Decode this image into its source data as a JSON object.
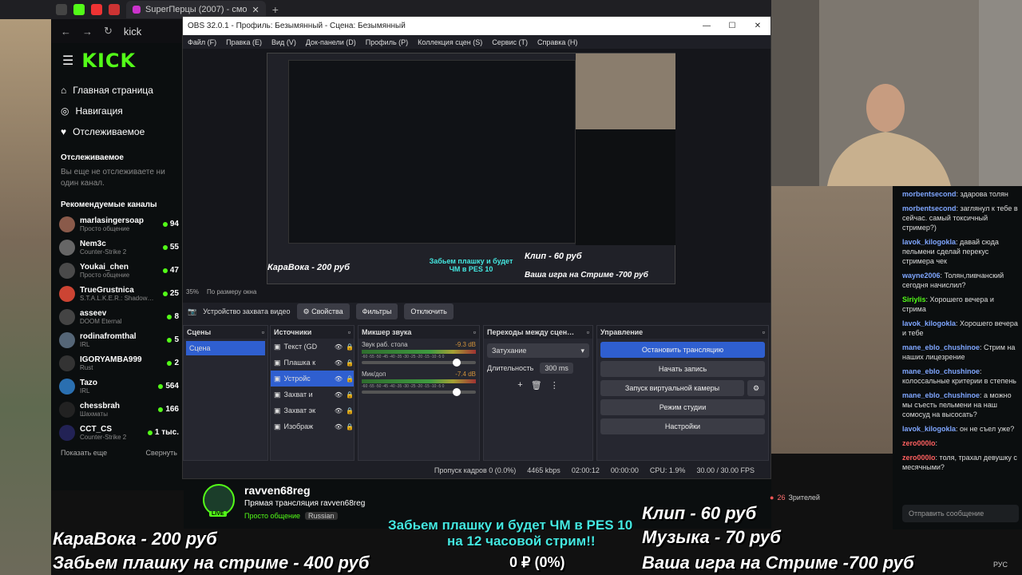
{
  "browser": {
    "tab_title": "SuperПерцы (2007) - смо",
    "address_prefix": "kick"
  },
  "kick": {
    "logo": "KICK",
    "nav": [
      {
        "label": "Главная страница",
        "icon": "home-icon"
      },
      {
        "label": "Навигация",
        "icon": "compass-icon"
      },
      {
        "label": "Отслеживаемое",
        "icon": "heart-icon"
      }
    ],
    "following_title": "Отслеживаемое",
    "following_empty": "Вы еще не отслеживаете ни один канал.",
    "recommended_title": "Рекомендуемые каналы",
    "channels": [
      {
        "name": "marlasingersoap",
        "category": "Просто общение",
        "viewers": "94"
      },
      {
        "name": "Nem3c",
        "category": "Counter-Strike 2",
        "viewers": "55"
      },
      {
        "name": "Youkai_chen",
        "category": "Просто общение",
        "viewers": "47"
      },
      {
        "name": "TrueGrustnica",
        "category": "S.T.A.L.K.E.R.: Shadow…",
        "viewers": "25"
      },
      {
        "name": "asseev",
        "category": "DOOM Eternal",
        "viewers": "8"
      },
      {
        "name": "rodinafromthal",
        "category": "IRL",
        "viewers": "5"
      },
      {
        "name": "IGORYAMBA999",
        "category": "Rust",
        "viewers": "2"
      },
      {
        "name": "Tazo",
        "category": "IRL",
        "viewers": "564"
      },
      {
        "name": "chessbrah",
        "category": "Шахматы",
        "viewers": "166"
      },
      {
        "name": "CCT_CS",
        "category": "Counter-Strike 2",
        "viewers": "1 тыс."
      }
    ],
    "show_more": "Показать еще",
    "collapse": "Свернуть"
  },
  "obs": {
    "title": "OBS 32.0.1 - Профиль: Безымянный - Сцена: Безымянный",
    "menu": [
      "Файл (F)",
      "Правка (E)",
      "Вид (V)",
      "Док-панели (D)",
      "Профиль (P)",
      "Коллекция сцен (S)",
      "Сервис (T)",
      "Справка (H)"
    ],
    "zoom": "35%",
    "zoom_mode": "По размеру окна",
    "source_toolbar": {
      "device": "Устройство захвата видео",
      "properties": "Свойства",
      "filters": "Фильтры",
      "deactivate": "Отключить"
    },
    "scenes_title": "Сцены",
    "scene_item": "Сцена",
    "sources_title": "Источники",
    "sources": [
      "Текст (GD",
      "Плашка к",
      "Устройс",
      "Захват и",
      "Захват эк",
      "Изображ"
    ],
    "mixer_title": "Микшер звука",
    "mixer": [
      {
        "name": "Звук раб. стола",
        "db": "-9.3 dB"
      },
      {
        "name": "Мик/доп",
        "db": "-7.4 dB"
      }
    ],
    "mixer_scale": "-60 -55 -50 -45 -40 -35 -30 -25 -20 -15 -10 -5 0",
    "transitions_title": "Переходы между сцен…",
    "transition": "Затухание",
    "duration_label": "Длительность",
    "duration": "300 ms",
    "controls_title": "Управление",
    "controls": {
      "stop_stream": "Остановить трансляцию",
      "start_record": "Начать запись",
      "virtual_cam": "Запуск виртуальной камеры",
      "studio_mode": "Режим студии",
      "settings": "Настройки"
    },
    "status": {
      "dropped": "Пропуск кадров 0 (0.0%)",
      "kbps": "4465 kbps",
      "live_time": "02:00:12",
      "rec_time": "00:00:00",
      "cpu": "CPU: 1.9%",
      "fps": "30.00 / 30.00 FPS"
    }
  },
  "streamer": {
    "name": "ravven68reg",
    "title": "Прямая трансляция ravven68reg",
    "category": "Просто общение",
    "language": "Russian",
    "live_badge": "LIVE",
    "viewers_label": "Зрителей",
    "viewers": "26"
  },
  "chat": {
    "messages": [
      {
        "user": "morbentsecond",
        "text": "здарова толян",
        "color": ""
      },
      {
        "user": "morbentsecond",
        "text": "заглянул к тебе в сейчас. самый токсичный стример?)",
        "color": ""
      },
      {
        "user": "lavok_kilogokla",
        "text": "давай сюда пельмени сделай перекус стримера чек",
        "color": ""
      },
      {
        "user": "wayne2006",
        "text": "Толян,пивчанский сегодня начислил?",
        "color": ""
      },
      {
        "user": "Siriylis",
        "text": "Хорошего вечера и стрима",
        "color": "green"
      },
      {
        "user": "lavok_kilogokla",
        "text": "Хорошего вечера и тебе",
        "color": ""
      },
      {
        "user": "mane_eblo_chushinoe",
        "text": "Стрим на наших лицезрение",
        "color": ""
      },
      {
        "user": "mane_eblo_chushinoe",
        "text": "колоссальные критерии в степень",
        "color": ""
      },
      {
        "user": "mane_eblo_chushinoe",
        "text": "а можно мы съесть пельмени на наш сомосуд на высосать?",
        "color": ""
      },
      {
        "user": "lavok_kilogokla",
        "text": "он не съел уже?",
        "color": ""
      },
      {
        "user": "zero000lo",
        "text": "",
        "color": "red"
      },
      {
        "user": "zero000lo",
        "text": "толя, трахал девушку с месячными?",
        "color": "red"
      }
    ],
    "input_placeholder": "Отправить сообщение"
  },
  "overlay": {
    "left1": "КараВока - 200 руб",
    "left2": "Забьем плашку на стриме - 400 руб",
    "center1": "Забьем плашку и будет ЧМ в PES 10",
    "center2": "на 12 часовой стрим!!",
    "donation": "0 ₽ (0%)",
    "right1": "Клип - 60 руб",
    "right2": "Музыка - 70 руб",
    "right3": "Ваша игра на Стриме -700 руб"
  },
  "taskbar": {
    "lang": "РУС"
  }
}
